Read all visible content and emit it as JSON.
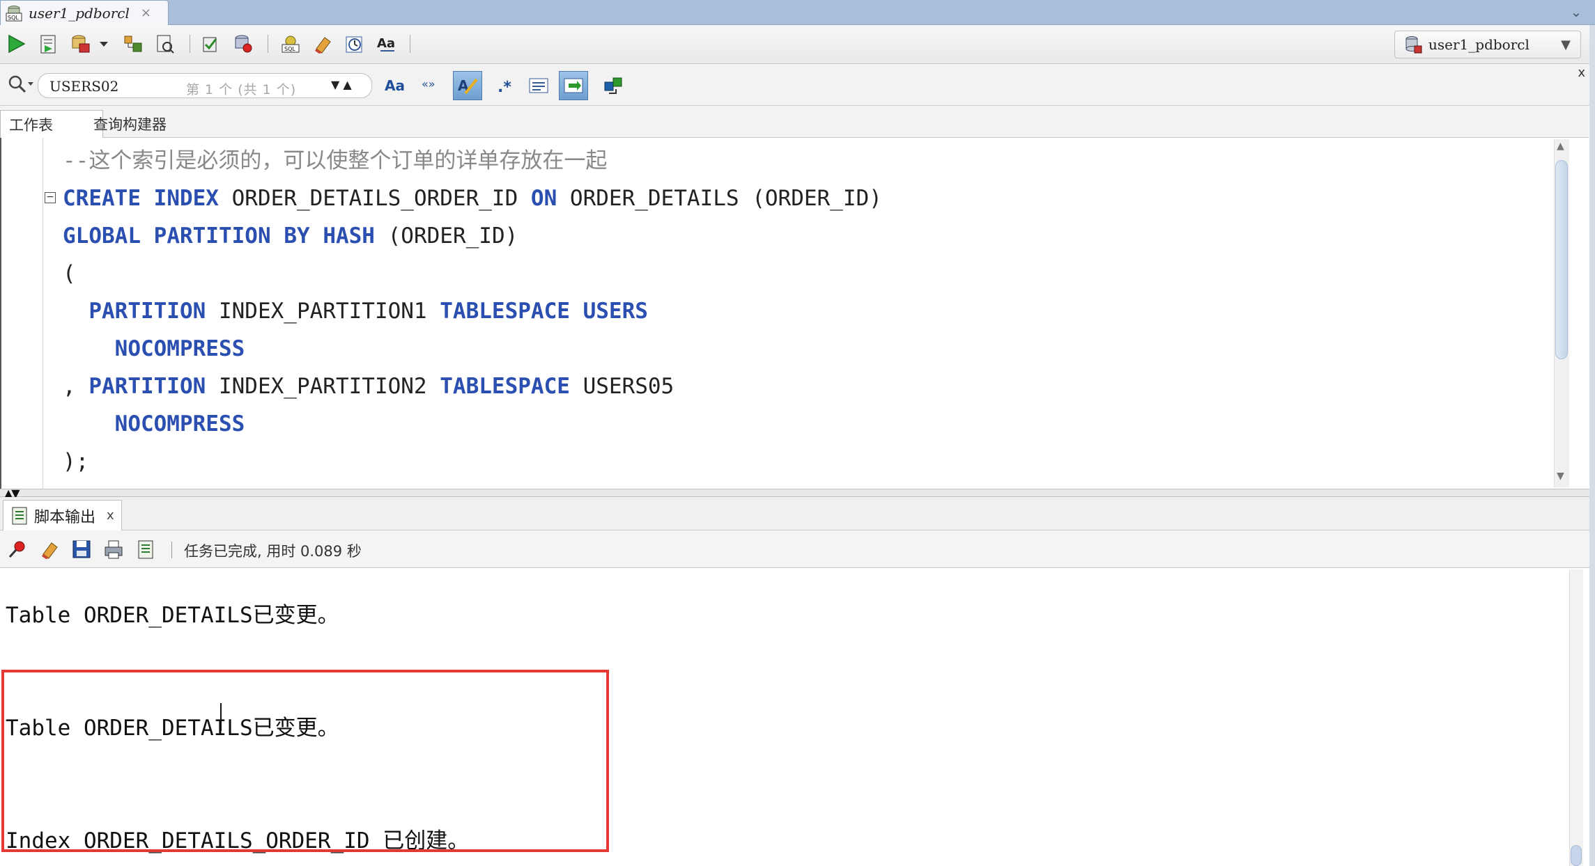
{
  "tab": {
    "title": "user1_pdborcl",
    "close": "×",
    "menu": "⌄"
  },
  "connection": {
    "label": "user1_pdborcl"
  },
  "find": {
    "query": "USERS02",
    "status": "第 1 个 (共 1 个)",
    "close": "x"
  },
  "editor_tabs": [
    "工作表",
    "查询构建器"
  ],
  "code_lines": [
    [
      {
        "t": "--这个索引是必须的，可以使整个订单的详单存放在一起",
        "c": "cm"
      }
    ],
    [
      {
        "t": "CREATE",
        "c": "kw"
      },
      {
        "t": " "
      },
      {
        "t": "INDEX",
        "c": "kw"
      },
      {
        "t": " ORDER_DETAILS_ORDER_ID "
      },
      {
        "t": "ON",
        "c": "kw"
      },
      {
        "t": " ORDER_DETAILS (ORDER_ID)"
      }
    ],
    [
      {
        "t": "GLOBAL",
        "c": "kw"
      },
      {
        "t": " "
      },
      {
        "t": "PARTITION",
        "c": "kw"
      },
      {
        "t": " "
      },
      {
        "t": "BY",
        "c": "kw"
      },
      {
        "t": " "
      },
      {
        "t": "HASH",
        "c": "kw"
      },
      {
        "t": " (ORDER_ID)"
      }
    ],
    [
      {
        "t": "("
      }
    ],
    [
      {
        "t": "  "
      },
      {
        "t": "PARTITION",
        "c": "kw"
      },
      {
        "t": " INDEX_PARTITION1 "
      },
      {
        "t": "TABLESPACE",
        "c": "kw"
      },
      {
        "t": " "
      },
      {
        "t": "USERS",
        "c": "kw"
      }
    ],
    [
      {
        "t": "    "
      },
      {
        "t": "NOCOMPRESS",
        "c": "kw"
      }
    ],
    [
      {
        "t": ", "
      },
      {
        "t": "PARTITION",
        "c": "kw"
      },
      {
        "t": " INDEX_PARTITION2 "
      },
      {
        "t": "TABLESPACE",
        "c": "kw"
      },
      {
        "t": " USERS05"
      }
    ],
    [
      {
        "t": "    "
      },
      {
        "t": "NOCOMPRESS",
        "c": "kw"
      }
    ],
    [
      {
        "t": ");"
      }
    ]
  ],
  "output_panel": {
    "tab_label": "脚本输出",
    "tab_close": "x",
    "status": "任务已完成, 用时 0.089 秒",
    "lines": [
      "Table ORDER_DETAILS已变更。",
      "Table ORDER_DETAILS已变更。",
      "Index ORDER_DETAILS_ORDER_ID 已创建。"
    ]
  },
  "colors": {
    "keyword": "#2a4fb0",
    "comment": "#888888",
    "highlight_box": "#e53935",
    "tabstrip": "#a9bfd9"
  },
  "icons": {
    "toolbar": [
      "run-statement-icon",
      "run-script-icon",
      "commit-icon",
      "dropdown-arrow-icon",
      "explain-plan-icon",
      "autotrace-icon",
      "sql-tuning-icon",
      "rollback-icon",
      "unshared-sql-icon",
      "clear-icon",
      "history-icon",
      "format-icon"
    ],
    "output_toolbar": [
      "pin-icon",
      "clear-output-icon",
      "save-icon",
      "print-icon",
      "open-file-icon"
    ]
  }
}
